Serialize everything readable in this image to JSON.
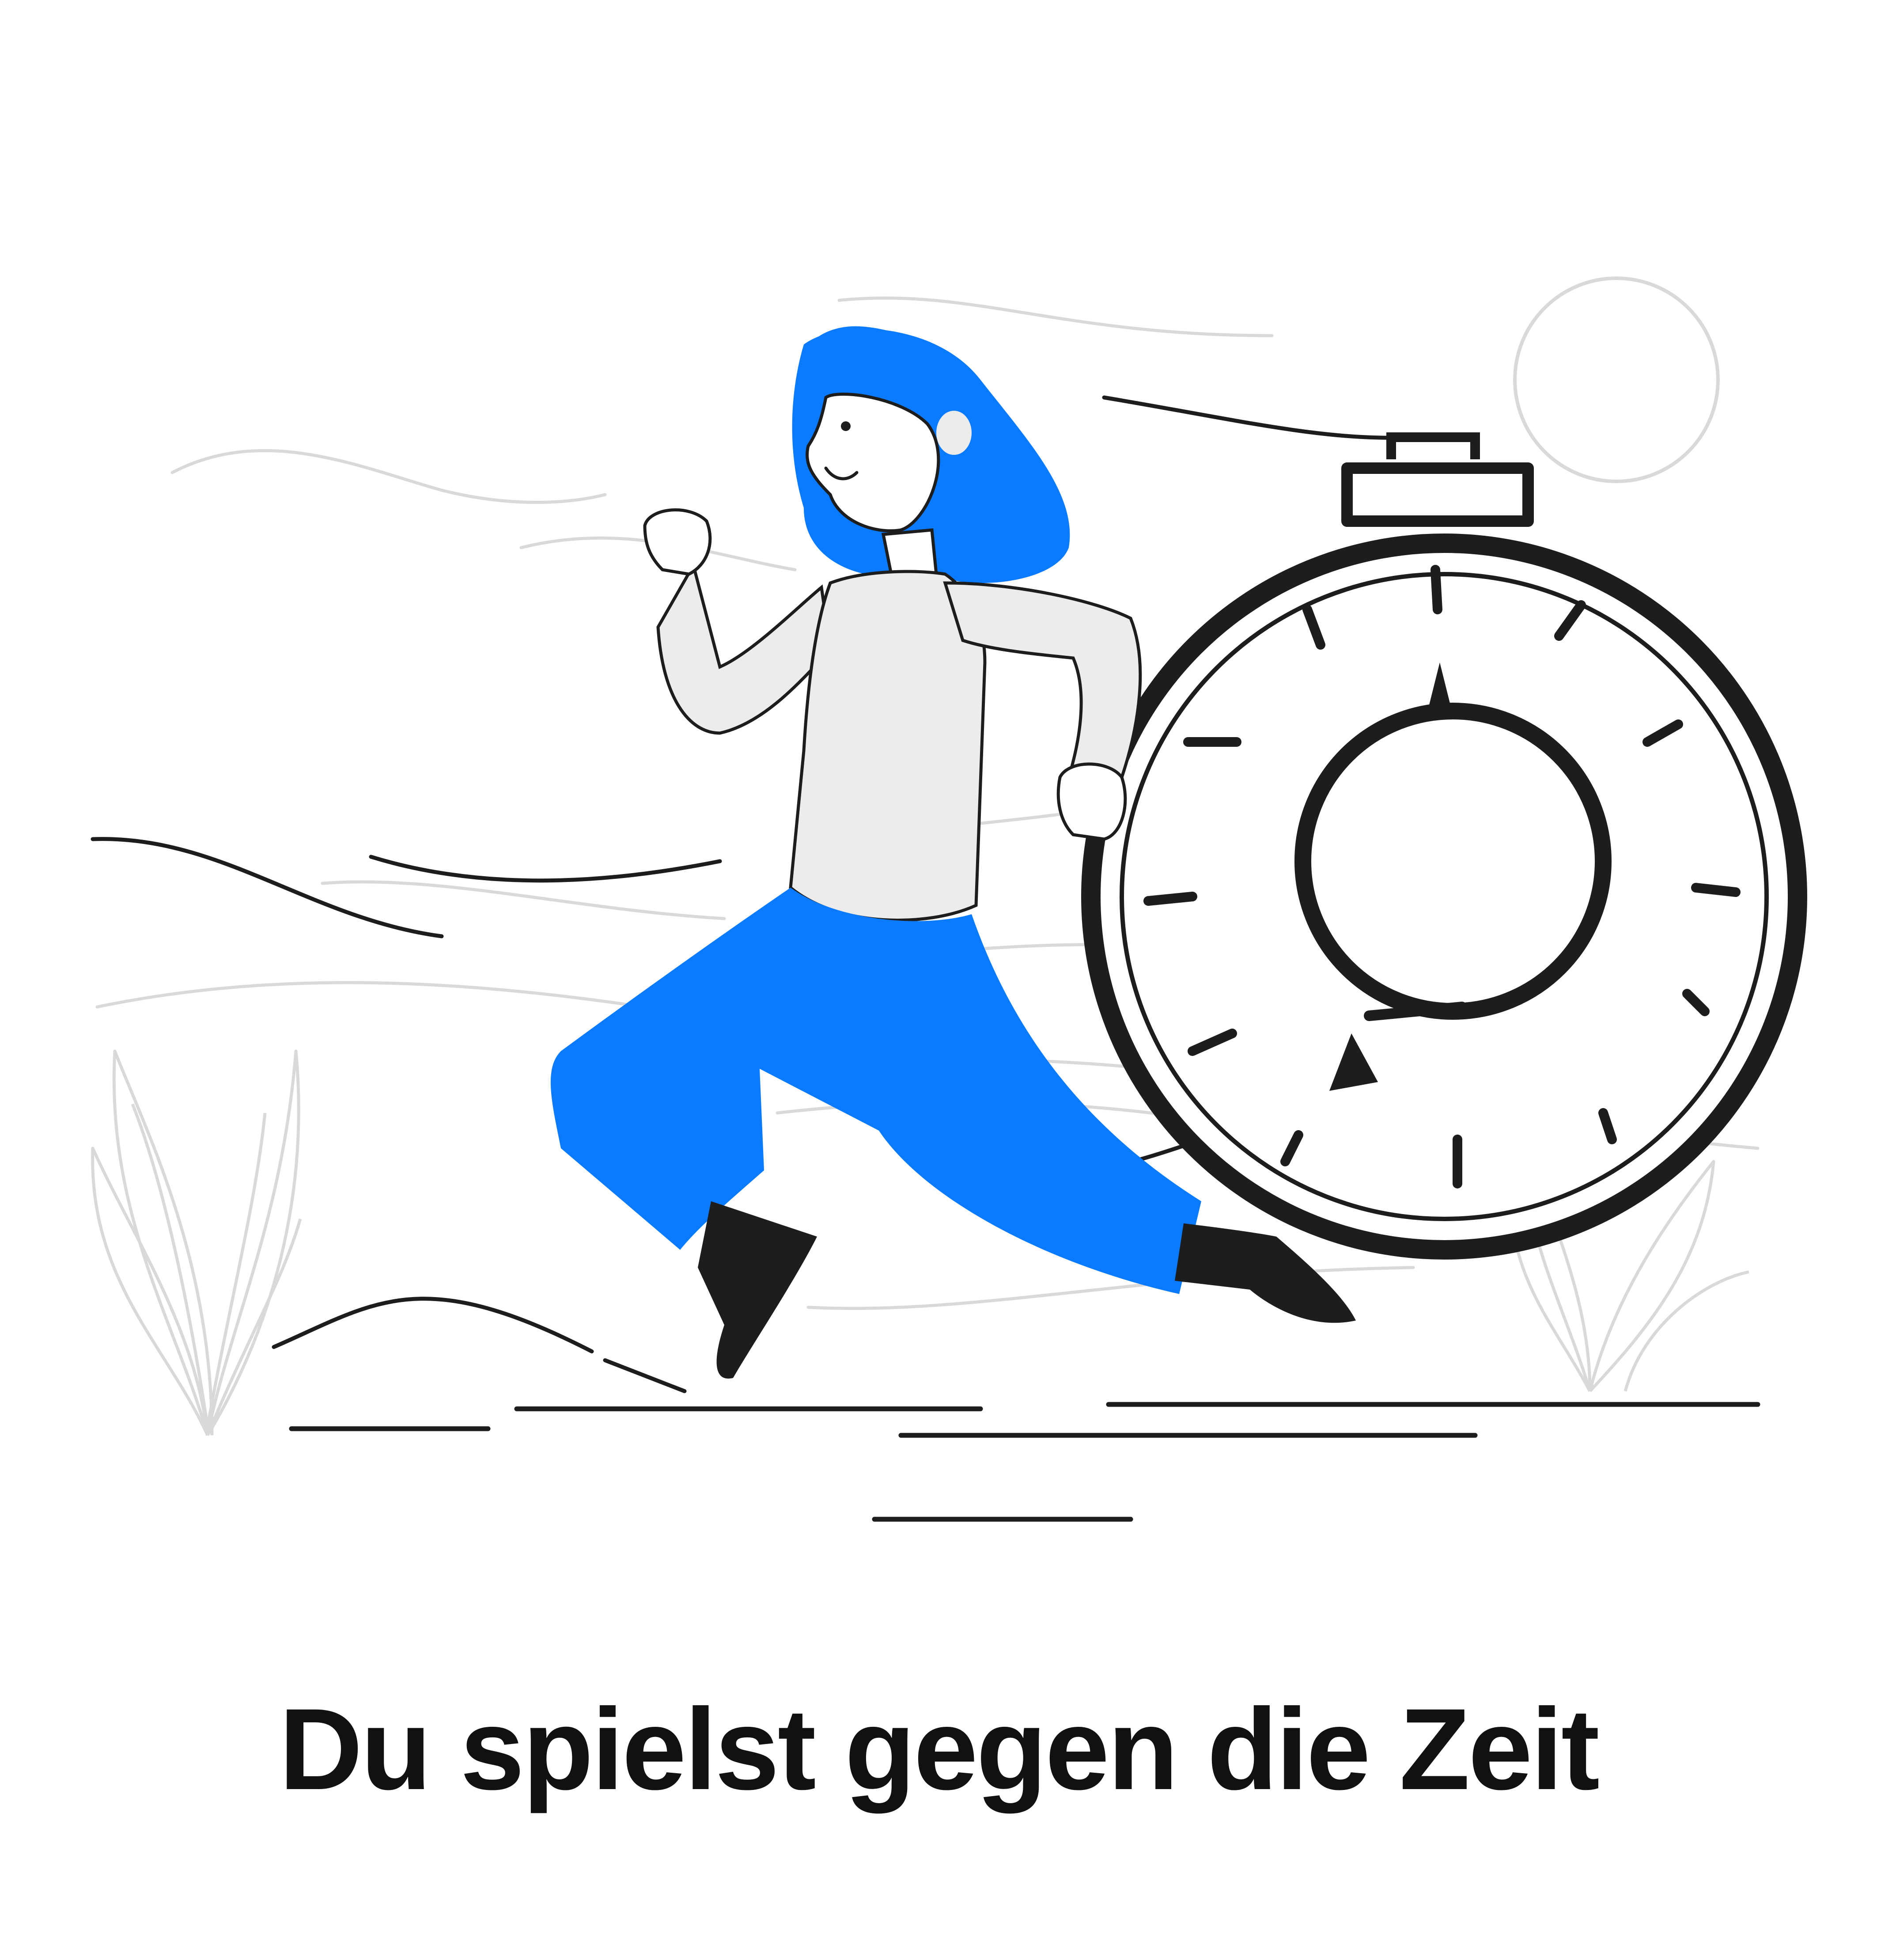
{
  "caption": "Du spielst gegen die Zeit",
  "colors": {
    "accent_blue": "#0A7BFF",
    "ink": "#1D1D1D",
    "sketch_gray": "#D9D9D9",
    "shirt_gray": "#ECECEC",
    "background": "#FFFFFF"
  },
  "illustration": {
    "subject": "woman-running-icon",
    "object": "stopwatch-icon"
  }
}
